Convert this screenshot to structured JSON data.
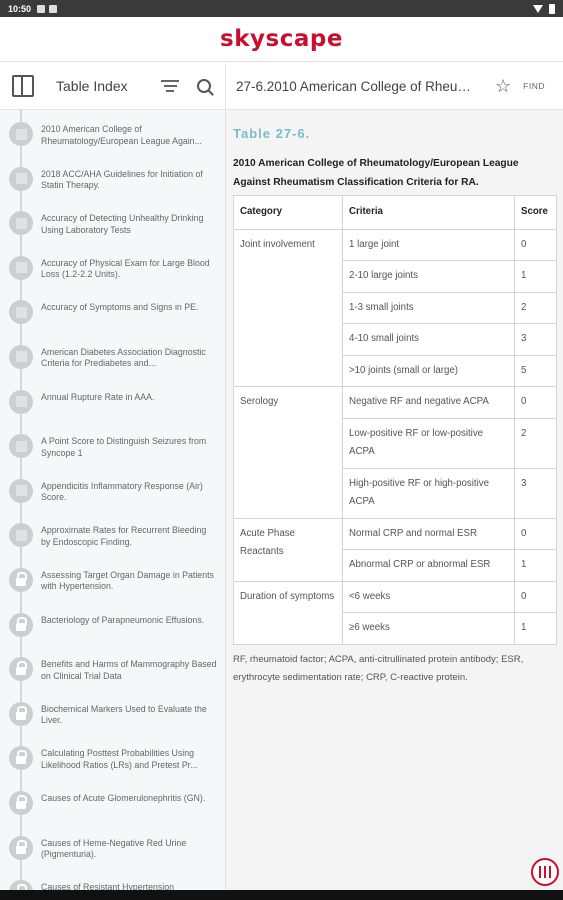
{
  "status_bar": {
    "time": "10:50"
  },
  "app": {
    "logo": "skyscape"
  },
  "sidebar": {
    "title": "Table Index",
    "items": [
      {
        "label": "2010 American College of Rheumatology/European League Again...",
        "locked": false
      },
      {
        "label": "2018 ACC/AHA Guidelines for Initiation of Statin Therapy.",
        "locked": false
      },
      {
        "label": "Accuracy of Detecting Unhealthy Drinking Using Laboratory Tests",
        "locked": false
      },
      {
        "label": "Accuracy of Physical Exam for Large Blood Loss (1.2-2.2 Units).",
        "locked": false
      },
      {
        "label": "Accuracy of Symptoms and Signs in PE.",
        "locked": false
      },
      {
        "label": "American Diabetes Association Diagnostic Criteria for Prediabetes and...",
        "locked": false
      },
      {
        "label": "Annual Rupture Rate in AAA.",
        "locked": false
      },
      {
        "label": "A Point Score to Distinguish Seizures from Syncope 1",
        "locked": false
      },
      {
        "label": "Appendicitis Inflammatory Response (Air) Score.",
        "locked": false
      },
      {
        "label": "Approximate Rates for Recurrent Bleeding by Endoscopic Finding.",
        "locked": false
      },
      {
        "label": "Assessing Target Organ Damage in Patients with Hypertension.",
        "locked": true
      },
      {
        "label": "Bacteriology of Parapneumonic Effusions.",
        "locked": true
      },
      {
        "label": "Benefits and Harms of Mammography Based on Clinical Trial Data",
        "locked": true
      },
      {
        "label": "Biochemical Markers Used to Evaluate the Liver.",
        "locked": true
      },
      {
        "label": "Calculating Posttest Probabilities Using Likelihood Ratios (LRs) and Pretest Pr...",
        "locked": true
      },
      {
        "label": "Causes of Acute Glomerulonephritis (GN).",
        "locked": true
      },
      {
        "label": "Causes of Heme-Negative Red Urine (Pigmenturia).",
        "locked": true
      },
      {
        "label": "Causes of Resistant Hypertension",
        "locked": true
      }
    ]
  },
  "main": {
    "title": "27-6.2010 American College of Rheumatology/European League Against Rheumatism Classification Criteria for RA.",
    "find_label": "FIND",
    "table_label": "Table 27-6.",
    "caption": "2010 American College of Rheumatology/European League Against Rheumatism Classification Criteria for RA.",
    "headers": {
      "category": "Category",
      "criteria": "Criteria",
      "score": "Score"
    },
    "groups": [
      {
        "category": "Joint involvement",
        "rows": [
          {
            "criteria": "1 large joint",
            "score": "0"
          },
          {
            "criteria": "2-10 large joints",
            "score": "1"
          },
          {
            "criteria": "1-3 small joints",
            "score": "2"
          },
          {
            "criteria": "4-10 small joints",
            "score": "3"
          },
          {
            "criteria": ">10 joints (small or large)",
            "score": "5"
          }
        ]
      },
      {
        "category": "Serology",
        "rows": [
          {
            "criteria": "Negative RF and negative ACPA",
            "score": "0"
          },
          {
            "criteria": "Low-positive RF or low-positive ACPA",
            "score": "2"
          },
          {
            "criteria": "High-positive RF or high-positive ACPA",
            "score": "3"
          }
        ]
      },
      {
        "category": "Acute Phase Reactants",
        "rows": [
          {
            "criteria": "Normal CRP and normal ESR",
            "score": "0"
          },
          {
            "criteria": "Abnormal CRP or abnormal ESR",
            "score": "1"
          }
        ]
      },
      {
        "category": "Duration of symptoms",
        "rows": [
          {
            "criteria": "<6 weeks",
            "score": "0"
          },
          {
            "criteria": "≥6 weeks",
            "score": "1"
          }
        ]
      }
    ],
    "footnote": "RF, rheumatoid factor; ACPA, anti-citrullinated protein antibody; ESR, erythrocyte sedimentation rate; CRP, C-reactive protein."
  },
  "colors": {
    "brand": "#c8102e",
    "accent": "#7cbcc6"
  }
}
